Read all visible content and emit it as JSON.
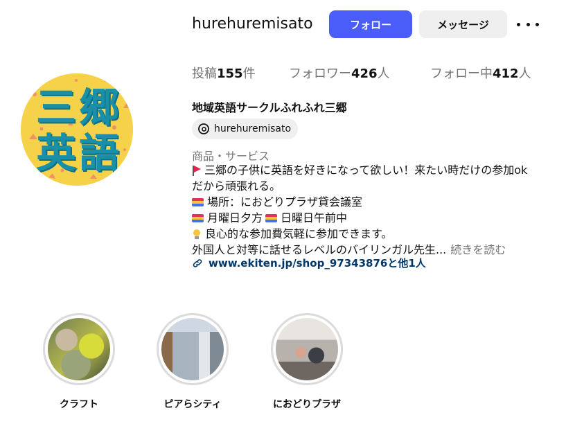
{
  "profile": {
    "username": "hurehuremisato",
    "avatar": {
      "line1": "三郷",
      "line2": "英語",
      "bg_color": "#f6d24a",
      "text_color": "#1a8fa8"
    },
    "follow_label": "フォロー",
    "message_label": "メッセージ",
    "more_icon": "more-horizontal-icon",
    "accent_color": "#4a5df9"
  },
  "stats": {
    "posts_label": "投稿",
    "posts_count": "155",
    "posts_suffix": "件",
    "followers_label": "フォロワー",
    "followers_count": "426",
    "followers_suffix": "人",
    "following_label": "フォロー中",
    "following_count": "412",
    "following_suffix": "人"
  },
  "bio": {
    "display_name": "地域英語サークルふれふれ三郷",
    "threads_handle": "hurehuremisato",
    "category": "商品・サービス",
    "line1": "三郷の子供に英語を好きになって欲しい！来たい時だけの参加ok",
    "line2": "だから頑張れる。",
    "line3": "場所：におどりプラザ貸会議室",
    "line4a": "月曜日夕方",
    "line4b": "日曜日午前中",
    "line5": "良心的な参加費気軽に参加できます。",
    "line6": "外国人と対等に話せるレベルのバイリンガル先生...",
    "read_more": "続きを読む",
    "link_text": "www.ekiten.jp/shop_97343876と他1人"
  },
  "highlights": [
    {
      "label": "クラフト"
    },
    {
      "label": "ピアらシティ"
    },
    {
      "label": "におどりプラザ"
    }
  ]
}
